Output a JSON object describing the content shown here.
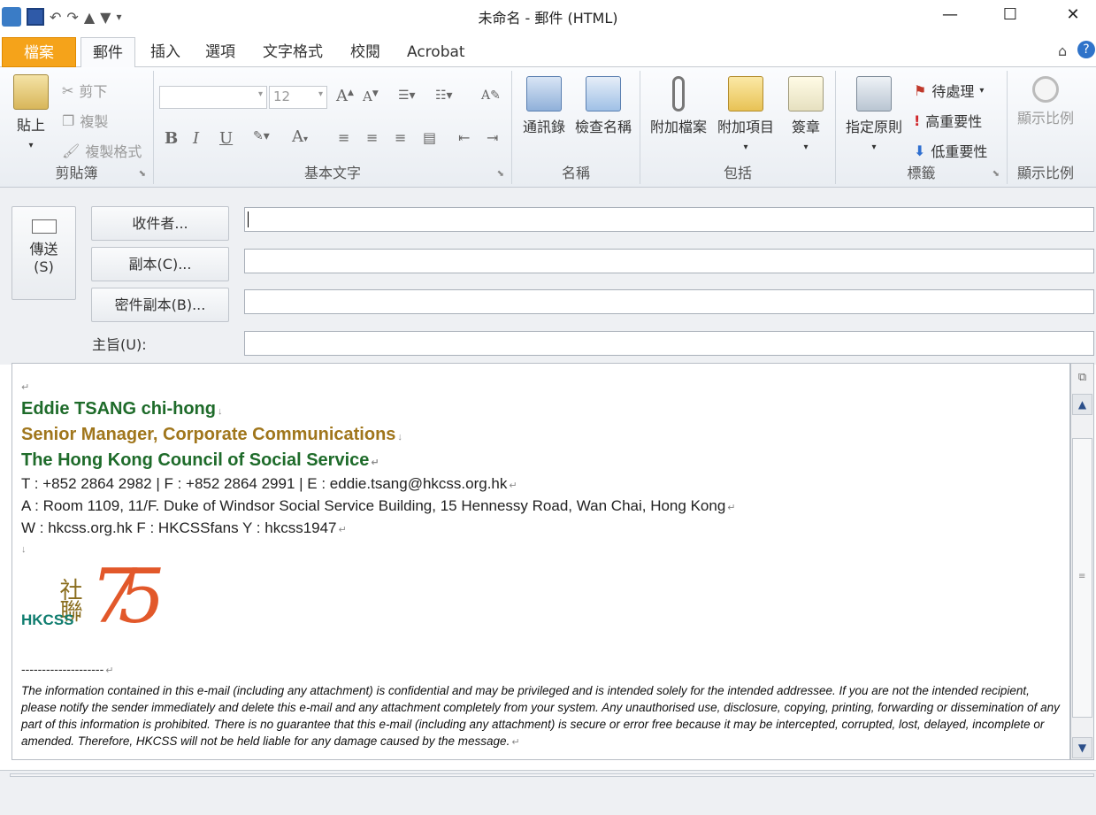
{
  "window": {
    "title": "未命名 - 郵件 (HTML)"
  },
  "tabs": [
    {
      "label": "檔案"
    },
    {
      "label": "郵件"
    },
    {
      "label": "插入"
    },
    {
      "label": "選項"
    },
    {
      "label": "文字格式"
    },
    {
      "label": "校閱"
    },
    {
      "label": "Acrobat"
    }
  ],
  "ribbon": {
    "clipboard": {
      "paste": "貼上",
      "cut": "剪下",
      "copy": "複製",
      "format_painter": "複製格式",
      "label": "剪貼簿"
    },
    "basic_text": {
      "font_size": "12",
      "label": "基本文字"
    },
    "names": {
      "address_book": "通訊錄",
      "check_names": "檢查名稱",
      "label": "名稱"
    },
    "include": {
      "attach_file": "附加檔案",
      "attach_item": "附加項目",
      "signature": "簽章",
      "label": "包括"
    },
    "tags": {
      "assign_policy": "指定原則",
      "follow_up": "待處理",
      "high_importance": "高重要性",
      "low_importance": "低重要性",
      "label": "標籤"
    },
    "zoom": {
      "zoom": "顯示比例",
      "label": "顯示比例"
    }
  },
  "compose": {
    "send_label": "傳送",
    "send_shortcut": "(S)",
    "to_button": "收件者...",
    "cc_button": "副本(C)...",
    "bcc_button": "密件副本(B)...",
    "subject_label": "主旨(U):",
    "to_value": "",
    "cc_value": "",
    "bcc_value": "",
    "subject_value": ""
  },
  "signature": {
    "name": "Eddie TSANG chi-hong",
    "title": "Senior Manager, Corporate Communications",
    "org": "The Hong Kong Council of Social Service",
    "contact": "T : +852 2864 2982 | F : +852 2864 2991 | E : eddie.tsang@hkcss.org.hk",
    "address": "A : Room 1109, 11/F. Duke of Windsor Social Service Building, 15 Hennessy Road, Wan Chai, Hong Kong",
    "web": "W : hkcss.org.hk   F : HKCSSfans   Y : hkcss1947",
    "logo_text": "HKCSS",
    "logo_chars": "社聯",
    "logo_number": "75",
    "separator": "--------------------",
    "disclaimer": "The information contained in this e-mail (including any attachment) is confidential and may be privileged and is intended solely for the intended addressee. If you are not the intended recipient, please notify the sender immediately and delete this e-mail and any attachment completely from your system. Any unauthorised use, disclosure, copying, printing, forwarding or dissemination of any part of this information is prohibited. There is no guarantee that this e-mail (including any attachment) is secure or error free because it may be intercepted, corrupted, lost, delayed, incomplete or amended. Therefore, HKCSS will not be held liable for any damage caused by the message."
  },
  "colors": {
    "file_tab": "#f5a31a",
    "sig_green": "#1e6b2a",
    "sig_gold": "#a0761c",
    "logo_teal": "#0f7d6f",
    "logo_orange": "#e2582a"
  }
}
